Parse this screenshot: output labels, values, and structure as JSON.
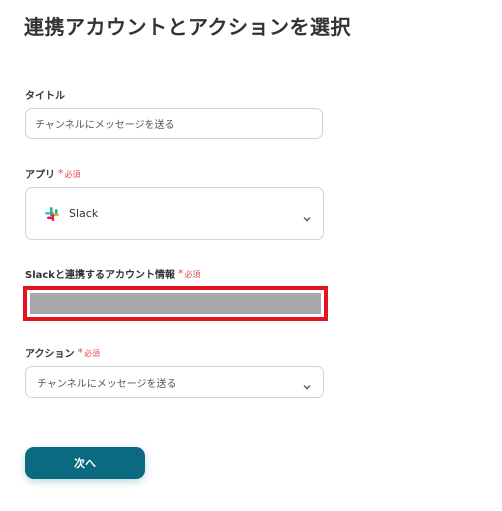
{
  "page": {
    "title": "連携アカウントとアクションを選択"
  },
  "colors": {
    "required": "#e5484d",
    "primary_button": "#0b6a80",
    "highlight_border": "#e3141f",
    "redacted": "#a8a8ab"
  },
  "title_field": {
    "label": "タイトル",
    "value": "チャンネルにメッセージを送る"
  },
  "app_field": {
    "label": "アプリ",
    "required_label": "必須",
    "selected_app": "Slack",
    "app_icon": "slack-logo-icon"
  },
  "account_field": {
    "label": "Slackと連携するアカウント情報",
    "required_label": "必須"
  },
  "action_field": {
    "label": "アクション",
    "required_label": "必須",
    "selected_value": "チャンネルにメッセージを送る"
  },
  "buttons": {
    "next_label": "次へ"
  }
}
